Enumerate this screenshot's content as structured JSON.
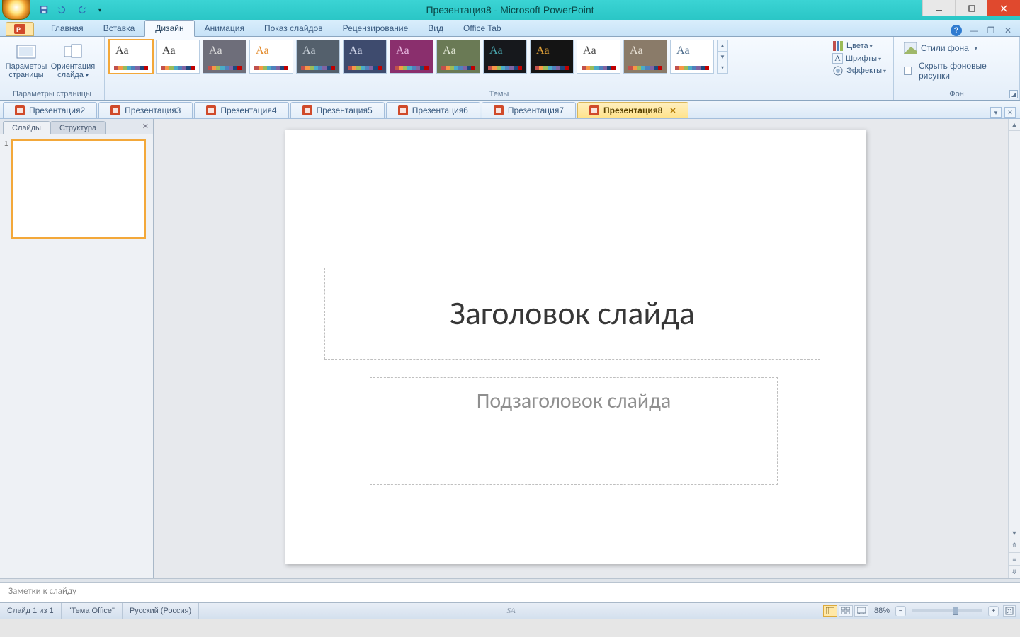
{
  "title": "Презентация8 - Microsoft PowerPoint",
  "ribbon_tabs": {
    "home": "Главная",
    "insert": "Вставка",
    "design": "Дизайн",
    "animation": "Анимация",
    "slideshow": "Показ слайдов",
    "review": "Рецензирование",
    "view": "Вид",
    "officetab": "Office Tab"
  },
  "page_setup": {
    "params": "Параметры страницы",
    "orient": "Ориентация слайда",
    "group": "Параметры страницы"
  },
  "themes_group": "Темы",
  "theme_thumbs": [
    {
      "bg": "#ffffff",
      "fg": "#3a3a3a"
    },
    {
      "bg": "#ffffff",
      "fg": "#3a3a3a"
    },
    {
      "bg": "#6e6e7a",
      "fg": "#dddddd"
    },
    {
      "bg": "#ffffff",
      "fg": "#e38b2c"
    },
    {
      "bg": "#54606c",
      "fg": "#c9d2da"
    },
    {
      "bg": "#3e4b6e",
      "fg": "#d0d6ea"
    },
    {
      "bg": "#8a2f6d",
      "fg": "#e7b8e0"
    },
    {
      "bg": "#6a7a55",
      "fg": "#e2e8d6"
    },
    {
      "bg": "#16181c",
      "fg": "#4aa8b0"
    },
    {
      "bg": "#141414",
      "fg": "#e2a238"
    },
    {
      "bg": "#ffffff",
      "fg": "#4a4a4a"
    },
    {
      "bg": "#8a7b69",
      "fg": "#e9e2d6"
    },
    {
      "bg": "#ffffff",
      "fg": "#4a6a8a"
    }
  ],
  "theme_side": {
    "colors": "Цвета",
    "fonts": "Шрифты",
    "effects": "Эффекты"
  },
  "bg_group": {
    "styles": "Стили фона",
    "hide": "Скрыть фоновые рисунки",
    "label": "Фон"
  },
  "doc_tabs": [
    "Презентация2",
    "Презентация3",
    "Презентация4",
    "Презентация5",
    "Презентация6",
    "Презентация7",
    "Презентация8"
  ],
  "side_tabs": {
    "slides": "Слайды",
    "outline": "Структура"
  },
  "slide": {
    "title": "Заголовок слайда",
    "subtitle": "Подзаголовок слайда"
  },
  "notes_placeholder": "Заметки к слайду",
  "status": {
    "slide": "Слайд 1 из 1",
    "theme": "\"Тема Office\"",
    "lang": "Русский (Россия)",
    "center": "SA",
    "zoom": "88%"
  },
  "swatch_colors": [
    "#c0504d",
    "#f79646",
    "#9bbb59",
    "#4bacc6",
    "#4f81bd",
    "#8064a2",
    "#1f497d",
    "#c00000"
  ]
}
